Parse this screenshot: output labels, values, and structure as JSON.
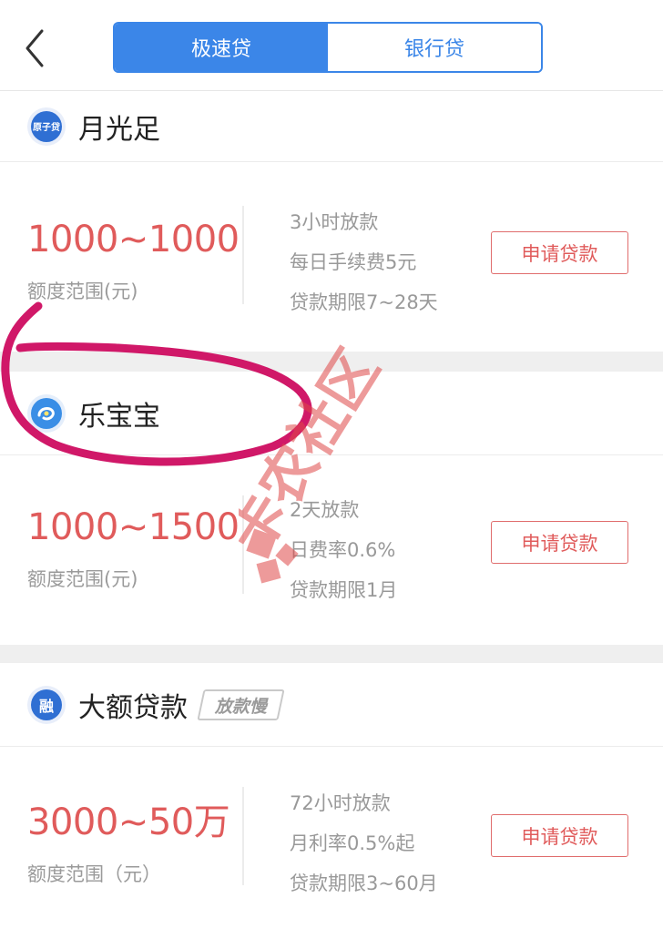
{
  "header": {
    "tabs": [
      {
        "label": "极速贷",
        "active": true
      },
      {
        "label": "银行贷",
        "active": false
      }
    ]
  },
  "products": [
    {
      "name": "月光足",
      "logo_text": "原子贷",
      "logo_color": "#2f6fd3",
      "amount": "1000~1000",
      "amount_label": "额度范围(元)",
      "details": [
        "3小时放款",
        "每日手续费5元",
        "贷款期限7~28天"
      ],
      "apply_label": "申请贷款"
    },
    {
      "name": "乐宝宝",
      "logo_color": "#3a8ee6",
      "amount": "1000~1500",
      "amount_label": "额度范围(元)",
      "details": [
        "2天放款",
        "日费率0.6%",
        "贷款期限1月"
      ],
      "apply_label": "申请贷款"
    },
    {
      "name": "大额贷款",
      "logo_text": "融",
      "logo_color": "#2f6fd3",
      "tag": "放款慢",
      "amount": "3000~50万",
      "amount_label": "额度范围（元）",
      "details": [
        "72小时放款",
        "月利率0.5%起",
        "贷款期限3~60月"
      ],
      "apply_label": "申请贷款"
    }
  ],
  "watermark": {
    "text": "卡农社区",
    "color": "#e04848"
  },
  "colors": {
    "accent_blue": "#3b86e8",
    "amount_red": "#e05b5b",
    "scribble": "#d01868"
  }
}
